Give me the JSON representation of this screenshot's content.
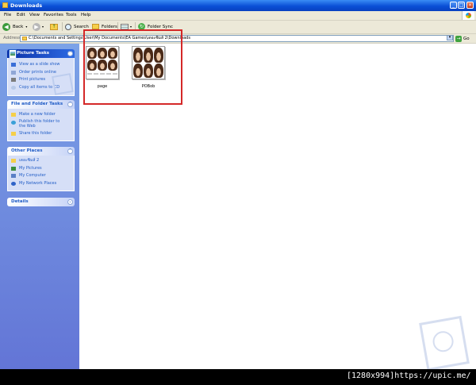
{
  "window": {
    "title": "Downloads",
    "controls": {
      "minimize": "_",
      "maximize": "□",
      "close": "×"
    }
  },
  "menu": [
    "File",
    "Edit",
    "View",
    "Favorites",
    "Tools",
    "Help"
  ],
  "toolbar": {
    "back": "Back",
    "search": "Search",
    "folders": "Folders",
    "folder_sync": "Folder Sync"
  },
  "address": {
    "label": "Address",
    "path": "C:\\Documents and Settings\\User\\My Documents\\EA Games\\เดอะซิมส์ 2\\Downloads",
    "go": "Go"
  },
  "sidebar": {
    "picture_tasks": {
      "title": "Picture Tasks",
      "items": [
        "View as a slide show",
        "Order prints online",
        "Print pictures",
        "Copy all items to CD"
      ]
    },
    "file_folder_tasks": {
      "title": "File and Folder Tasks",
      "items": [
        "Make a new folder",
        "Publish this folder to the Web",
        "Share this folder"
      ]
    },
    "other_places": {
      "title": "Other Places",
      "items": [
        "เดอะซิมส์ 2",
        "My Pictures",
        "My Computer",
        "My Network Places"
      ]
    },
    "details": {
      "title": "Details"
    }
  },
  "files": [
    {
      "name": "page",
      "icon": "image-thumbnail"
    },
    {
      "name": "POBob",
      "icon": "image-thumbnail"
    }
  ],
  "caption": "[1280x994]https://upic.me/",
  "colors": {
    "highlight": "#d42828",
    "sidebar": "#6b8bdc",
    "titlebar": "#0a4fd6"
  }
}
